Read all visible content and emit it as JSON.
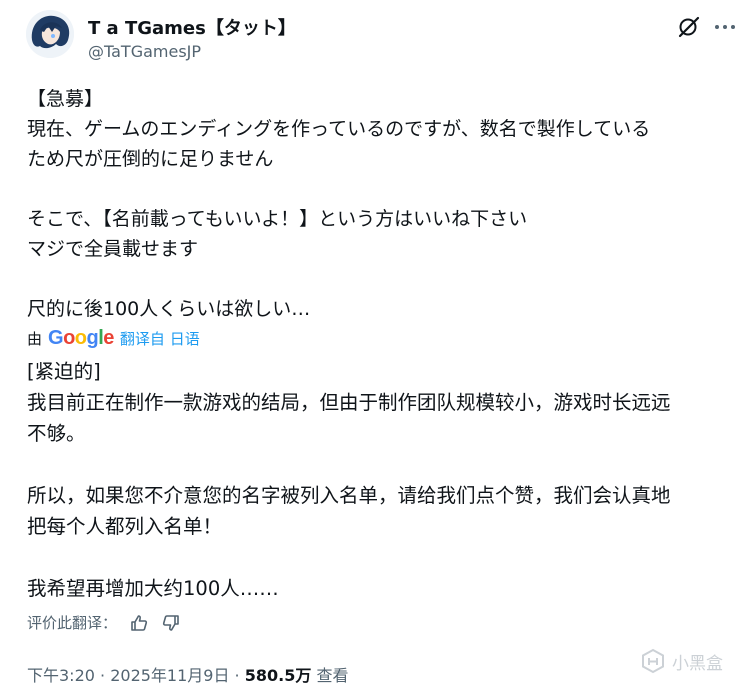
{
  "author": {
    "name": "T a TGames【タット】",
    "handle": "@TaTGamesJP"
  },
  "post": {
    "original_text": "【急募】\n現在、ゲームのエンディングを作っているのですが、数名で製作している\nため尺が圧倒的に足りません\n\nそこで、【名前載ってもいいよ！】という方はいいね下さい\nマジで全員載せます\n\n尺的に後100人くらいは欲しい…",
    "translation_by": "由",
    "translation_provider": "Google",
    "translated_from": "翻译自 日语",
    "translated_text": "[紧迫的]\n我目前正在制作一款游戏的结局，但由于制作团队规模较小，游戏时长远远\n不够。\n\n所以，如果您不介意您的名字被列入名单，请给我们点个赞，我们会认真地\n把每个人都列入名单！\n\n我希望再增加大约100人……",
    "rate_label": "评价此翻译：",
    "time": "下午3:20",
    "sep1": " · ",
    "date": "2025年11月9日",
    "sep2": " · ",
    "views_count": "580.5万",
    "views_label": " 查看"
  },
  "watermark": {
    "text": "小黑盒"
  },
  "icons": {
    "grok": "grok-icon",
    "more": "more-icon",
    "thumb_up": "thumb-up-icon",
    "thumb_down": "thumb-down-icon"
  },
  "colors": {
    "link": "#1d9bf0",
    "secondary": "#536471",
    "text": "#0f1419"
  }
}
